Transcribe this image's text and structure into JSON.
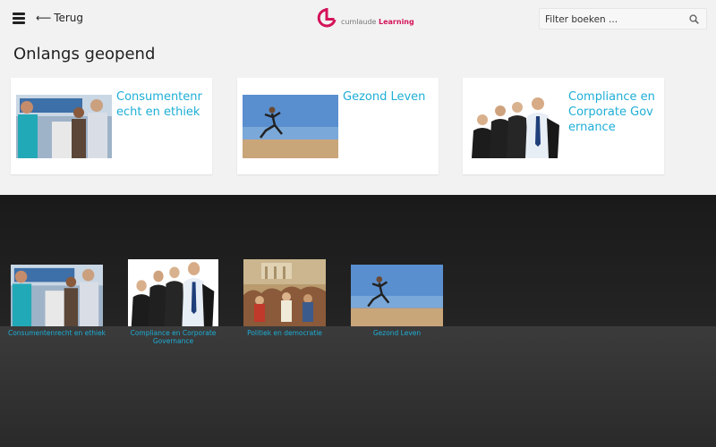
{
  "header": {
    "back_label": "Terug",
    "logo_prefix": "cumlaude ",
    "logo_brand": "Learning",
    "search_placeholder": "Filter boeken ..."
  },
  "recent": {
    "title": "Onlangs geopend",
    "cards": [
      {
        "title": "Consumentenrecht en ethiek",
        "image": "shop-assistant-customers"
      },
      {
        "title": "Gezond Leven",
        "image": "runner-beach"
      },
      {
        "title": "Compliance en Corporate Governance",
        "image": "business-team"
      }
    ]
  },
  "shelf": {
    "books": [
      {
        "title": "Consumentenrecht en ethiek",
        "image": "shop-assistant-customers"
      },
      {
        "title": "Compliance en Corporate Governance",
        "image": "business-team"
      },
      {
        "title": "Politiek en democratie",
        "image": "classical-painting-crowd"
      },
      {
        "title": "Gezond Leven",
        "image": "runner-beach"
      }
    ]
  },
  "colors": {
    "accent": "#1eaed6",
    "brand": "#d4145a",
    "shelf": "#222222"
  }
}
